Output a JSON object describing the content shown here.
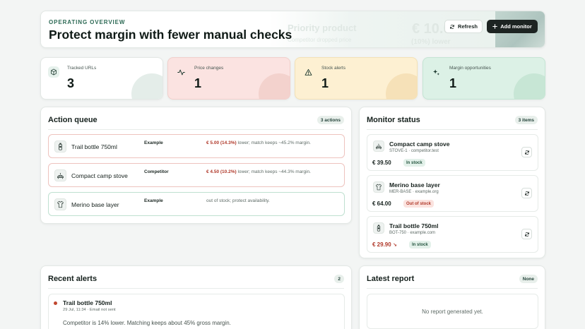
{
  "header": {
    "eyebrow": "OPERATING OVERVIEW",
    "title": "Protect margin with fewer manual checks",
    "refresh_label": "Refresh",
    "add_label": "Add monitor",
    "ghost": {
      "title": "Priority product",
      "subtitle": "Competitor dropped price",
      "price": "€ 10.0",
      "delta": "(10%) lower"
    }
  },
  "stats": [
    {
      "label": "Tracked URLs",
      "value": "3",
      "icon": "box-icon"
    },
    {
      "label": "Price changes",
      "value": "1",
      "icon": "activity-icon"
    },
    {
      "label": "Stock alerts",
      "value": "1",
      "icon": "warning-icon"
    },
    {
      "label": "Margin opportunities",
      "value": "1",
      "icon": "sparkle-icon"
    }
  ],
  "action_queue": {
    "title": "Action queue",
    "count": "3 actions",
    "items": [
      {
        "name": "Trail bottle 750ml",
        "source": "Example",
        "amount": "€ 5.00 (14.3%)",
        "message": " lower; match keeps ~45.2% margin."
      },
      {
        "name": "Compact camp stove",
        "source": "Competitor",
        "amount": "€ 4.50 (10.2%)",
        "message": " lower; match keeps ~44.3% margin."
      },
      {
        "name": "Merino base layer",
        "source": "Example",
        "amount": "",
        "message": "out of stock; protect availability."
      }
    ]
  },
  "monitor_status": {
    "title": "Monitor status",
    "count": "3 items",
    "items": [
      {
        "name": "Compact camp stove",
        "sub": "STOVE-1 · competitor.test",
        "price": "€ 39.50",
        "trend": "",
        "status": "In stock"
      },
      {
        "name": "Merino base layer",
        "sub": "MER-BASE · example.org",
        "price": "€ 64.00",
        "trend": "",
        "status": "Out of stock"
      },
      {
        "name": "Trail bottle 750ml",
        "sub": "BOT-750 · example.com",
        "price": "€ 29.90",
        "trend": "↘",
        "status": "In stock"
      }
    ]
  },
  "recent_alerts": {
    "title": "Recent alerts",
    "count": "2",
    "items": [
      {
        "name": "Trail bottle 750ml",
        "meta": "29 Jul, 11:34 · Email not sent",
        "text": "Competitor is 14% lower. Matching keeps about 45% gross margin."
      }
    ]
  },
  "latest_report": {
    "title": "Latest report",
    "badge": "None",
    "empty": "No report generated yet."
  },
  "colors": {
    "accent_dark": "#1d2422",
    "brand_green": "#2d6a55",
    "danger": "#b0392a",
    "stat_blue": "#ffffff",
    "stat_red": "#fbe3e1",
    "stat_yellow": "#fdf0d2",
    "stat_green": "#dcf1e6"
  }
}
